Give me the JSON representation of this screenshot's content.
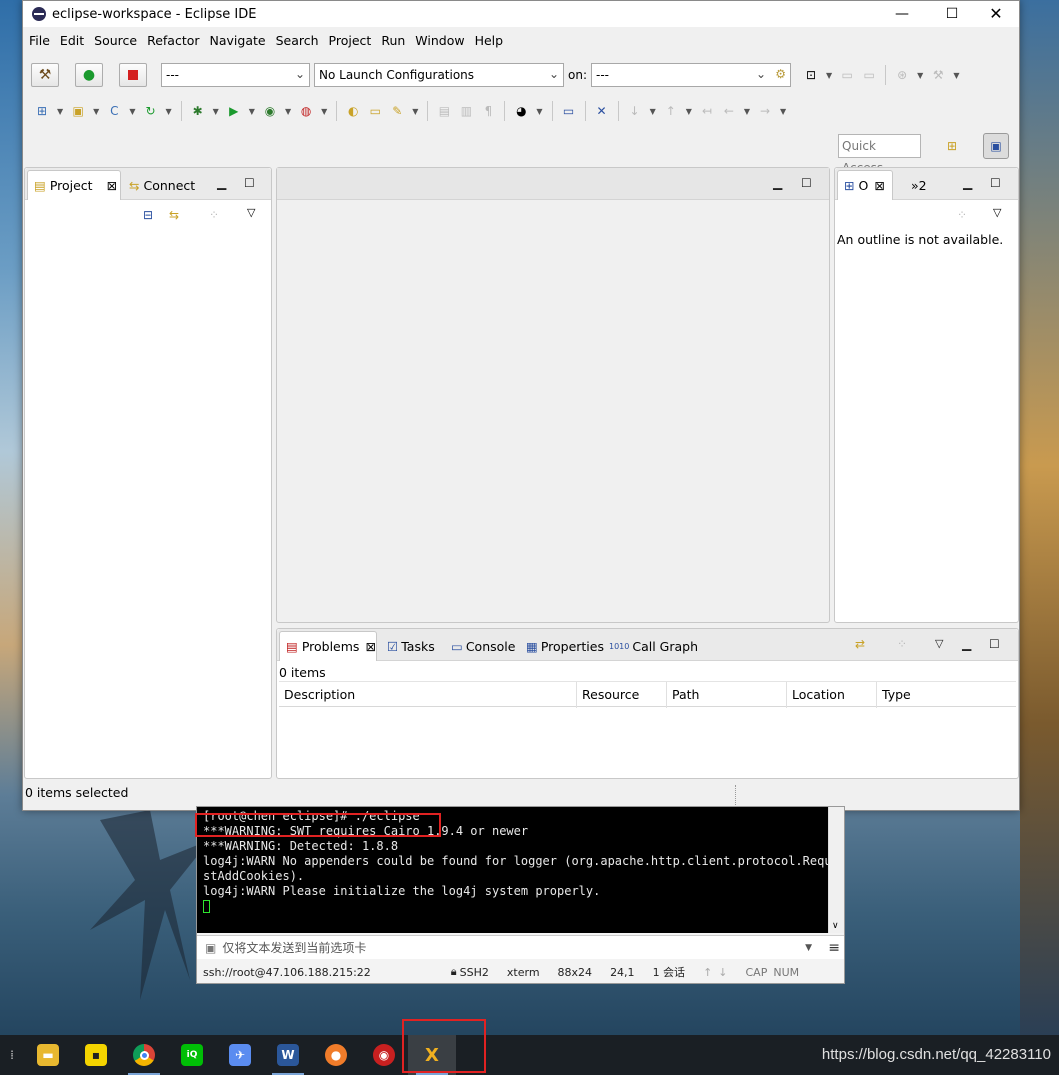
{
  "window": {
    "title": "eclipse-workspace - Eclipse IDE"
  },
  "menu": [
    "File",
    "Edit",
    "Source",
    "Refactor",
    "Navigate",
    "Search",
    "Project",
    "Run",
    "Window",
    "Help"
  ],
  "toolbar": {
    "run_combo": "---",
    "launch_config": "No Launch Configurations",
    "on_label": "on:",
    "target_combo": "---",
    "quick_access": "Quick Access"
  },
  "project_panel": {
    "tab_project": "Project",
    "tab_connect": "Connect"
  },
  "outline_panel": {
    "tab_label": "O",
    "overflow_label": "»2",
    "message": "An outline is not available."
  },
  "bottom_panel": {
    "tabs": [
      "Problems",
      "Tasks",
      "Console",
      "Properties",
      "Call Graph"
    ],
    "count": "0 items",
    "columns": [
      "Description",
      "Resource",
      "Path",
      "Location",
      "Type"
    ]
  },
  "status": {
    "left": "0 items selected"
  },
  "terminal": {
    "lines": [
      "[root@chen eclipse]# ./eclipse",
      "***WARNING: SWT requires Cairo 1.9.4 or newer",
      "***WARNING: Detected: 1.8.8",
      "log4j:WARN No appenders could be found for logger (org.apache.http.client.protocol.Reque",
      "stAddCookies).",
      "log4j:WARN Please initialize the log4j system properly."
    ],
    "input_placeholder": "仅将文本发送到当前选项卡",
    "status": {
      "session": "ssh://root@47.106.188.215:22",
      "protocol": "SSH2",
      "terminal": "xterm",
      "size": "88x24",
      "cursor": "24,1",
      "sessions": "1 会话",
      "caps": "CAP",
      "num": "NUM"
    }
  },
  "watermark": "https://blog.csdn.net/qq_42283110",
  "colors": {
    "highlight": "#e12222",
    "terminal_bg": "#000000",
    "taskbar_bg": "#1a1f24"
  }
}
